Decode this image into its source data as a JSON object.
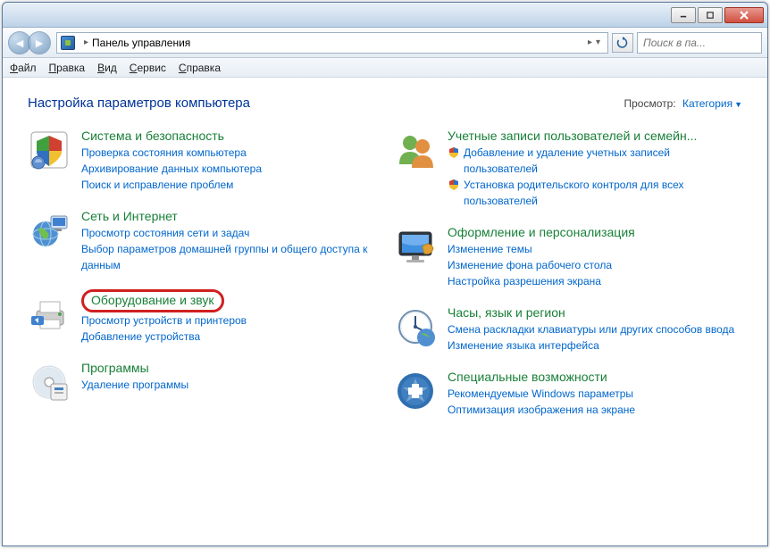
{
  "window": {
    "address_label": "Панель управления",
    "address_arrow_after": "▸",
    "search_placeholder": "Поиск в па..."
  },
  "menubar": [
    "Файл",
    "Правка",
    "Вид",
    "Сервис",
    "Справка"
  ],
  "header": {
    "title": "Настройка параметров компьютера",
    "view_label": "Просмотр:",
    "view_value": "Категория"
  },
  "left_cats": [
    {
      "icon": "shield",
      "title": "Система и безопасность",
      "links": [
        {
          "text": "Проверка состояния компьютера"
        },
        {
          "text": "Архивирование данных компьютера"
        },
        {
          "text": "Поиск и исправление проблем"
        }
      ]
    },
    {
      "icon": "globe",
      "title": "Сеть и Интернет",
      "links": [
        {
          "text": "Просмотр состояния сети и задач"
        },
        {
          "text": "Выбор параметров домашней группы и общего доступа к данным"
        }
      ]
    },
    {
      "icon": "printer",
      "title": "Оборудование и звук",
      "highlighted": true,
      "links": [
        {
          "text": "Просмотр устройств и принтеров"
        },
        {
          "text": "Добавление устройства"
        }
      ]
    },
    {
      "icon": "disc",
      "title": "Программы",
      "links": [
        {
          "text": "Удаление программы"
        }
      ]
    }
  ],
  "right_cats": [
    {
      "icon": "users",
      "title": "Учетные записи пользователей и семейн...",
      "links": [
        {
          "text": "Добавление и удаление учетных записей пользователей",
          "shield": true
        },
        {
          "text": "Установка родительского контроля для всех пользователей",
          "shield": true
        }
      ]
    },
    {
      "icon": "monitor",
      "title": "Оформление и персонализация",
      "links": [
        {
          "text": "Изменение темы"
        },
        {
          "text": "Изменение фона рабочего стола"
        },
        {
          "text": "Настройка разрешения экрана"
        }
      ]
    },
    {
      "icon": "clock",
      "title": "Часы, язык и регион",
      "links": [
        {
          "text": "Смена раскладки клавиатуры или других способов ввода"
        },
        {
          "text": "Изменение языка интерфейса"
        }
      ]
    },
    {
      "icon": "access",
      "title": "Специальные возможности",
      "links": [
        {
          "text": "Рекомендуемые Windows параметры"
        },
        {
          "text": "Оптимизация изображения на экране"
        }
      ]
    }
  ]
}
